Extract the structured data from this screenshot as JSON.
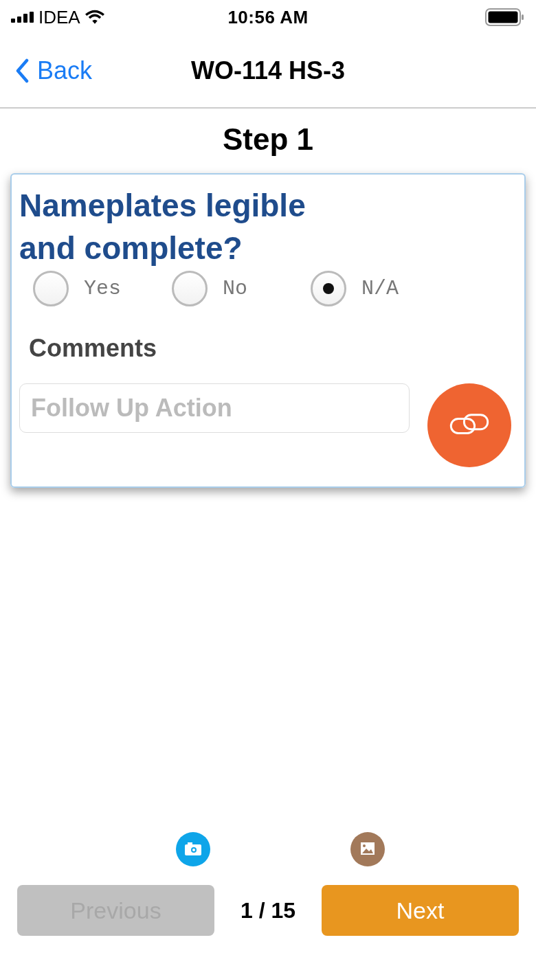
{
  "status_bar": {
    "carrier": "IDEA",
    "time": "10:56 AM"
  },
  "nav": {
    "back": "Back",
    "title": "WO-114 HS-3"
  },
  "step": "Step 1",
  "question": {
    "text": "Nameplates legible and complete?",
    "options": [
      {
        "label": "Yes",
        "selected": false
      },
      {
        "label": "No",
        "selected": false
      },
      {
        "label": "N/A",
        "selected": true
      }
    ],
    "comments_label": "Comments",
    "follow_up": {
      "placeholder": "Follow Up Action"
    }
  },
  "footer": {
    "buttons": [
      {
        "label": "Previous",
        "disabled": true
      },
      {
        "label": "Next",
        "disabled": false
      }
    ],
    "counter": "1 / 15"
  }
}
